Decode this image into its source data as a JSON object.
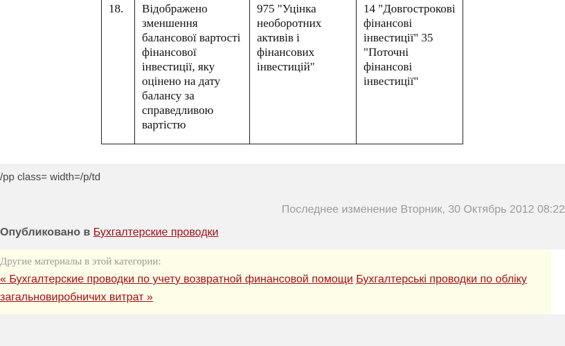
{
  "table": {
    "row": {
      "number": "18.",
      "description": "Відображено зменшення балансової вартості фінансової інвестиції, яку оцінено на дату балансу за справедливою вартістю",
      "debit": "975 \"Уцінка необоротних активів і фінансових інвестицій\"",
      "credit": "14 \"Довгострокові фінансові інвестиції\" 35 \"Поточні фінансові інвестиції\""
    }
  },
  "raw_text": "/pp class= width=/p/td",
  "meta": {
    "modified": "Последнее изменение Вторник, 30 Октябрь 2012 08:22",
    "published_label": "Опубликовано в",
    "published_category": "Бухгалтерские проводки"
  },
  "related": {
    "heading": "Другие материалы в этой категории:",
    "prev_link": "« Бухгалтерские проводки по учету возвратной финансовой помощи",
    "next_link": "Бухгалтерські проводки по обліку загальновиробничих витрат »"
  },
  "colors": {
    "link": "#a20e16",
    "muted_text": "#9b9b9b",
    "band_bg": "#f2f2f2",
    "related_bg": "#fdfde8"
  }
}
